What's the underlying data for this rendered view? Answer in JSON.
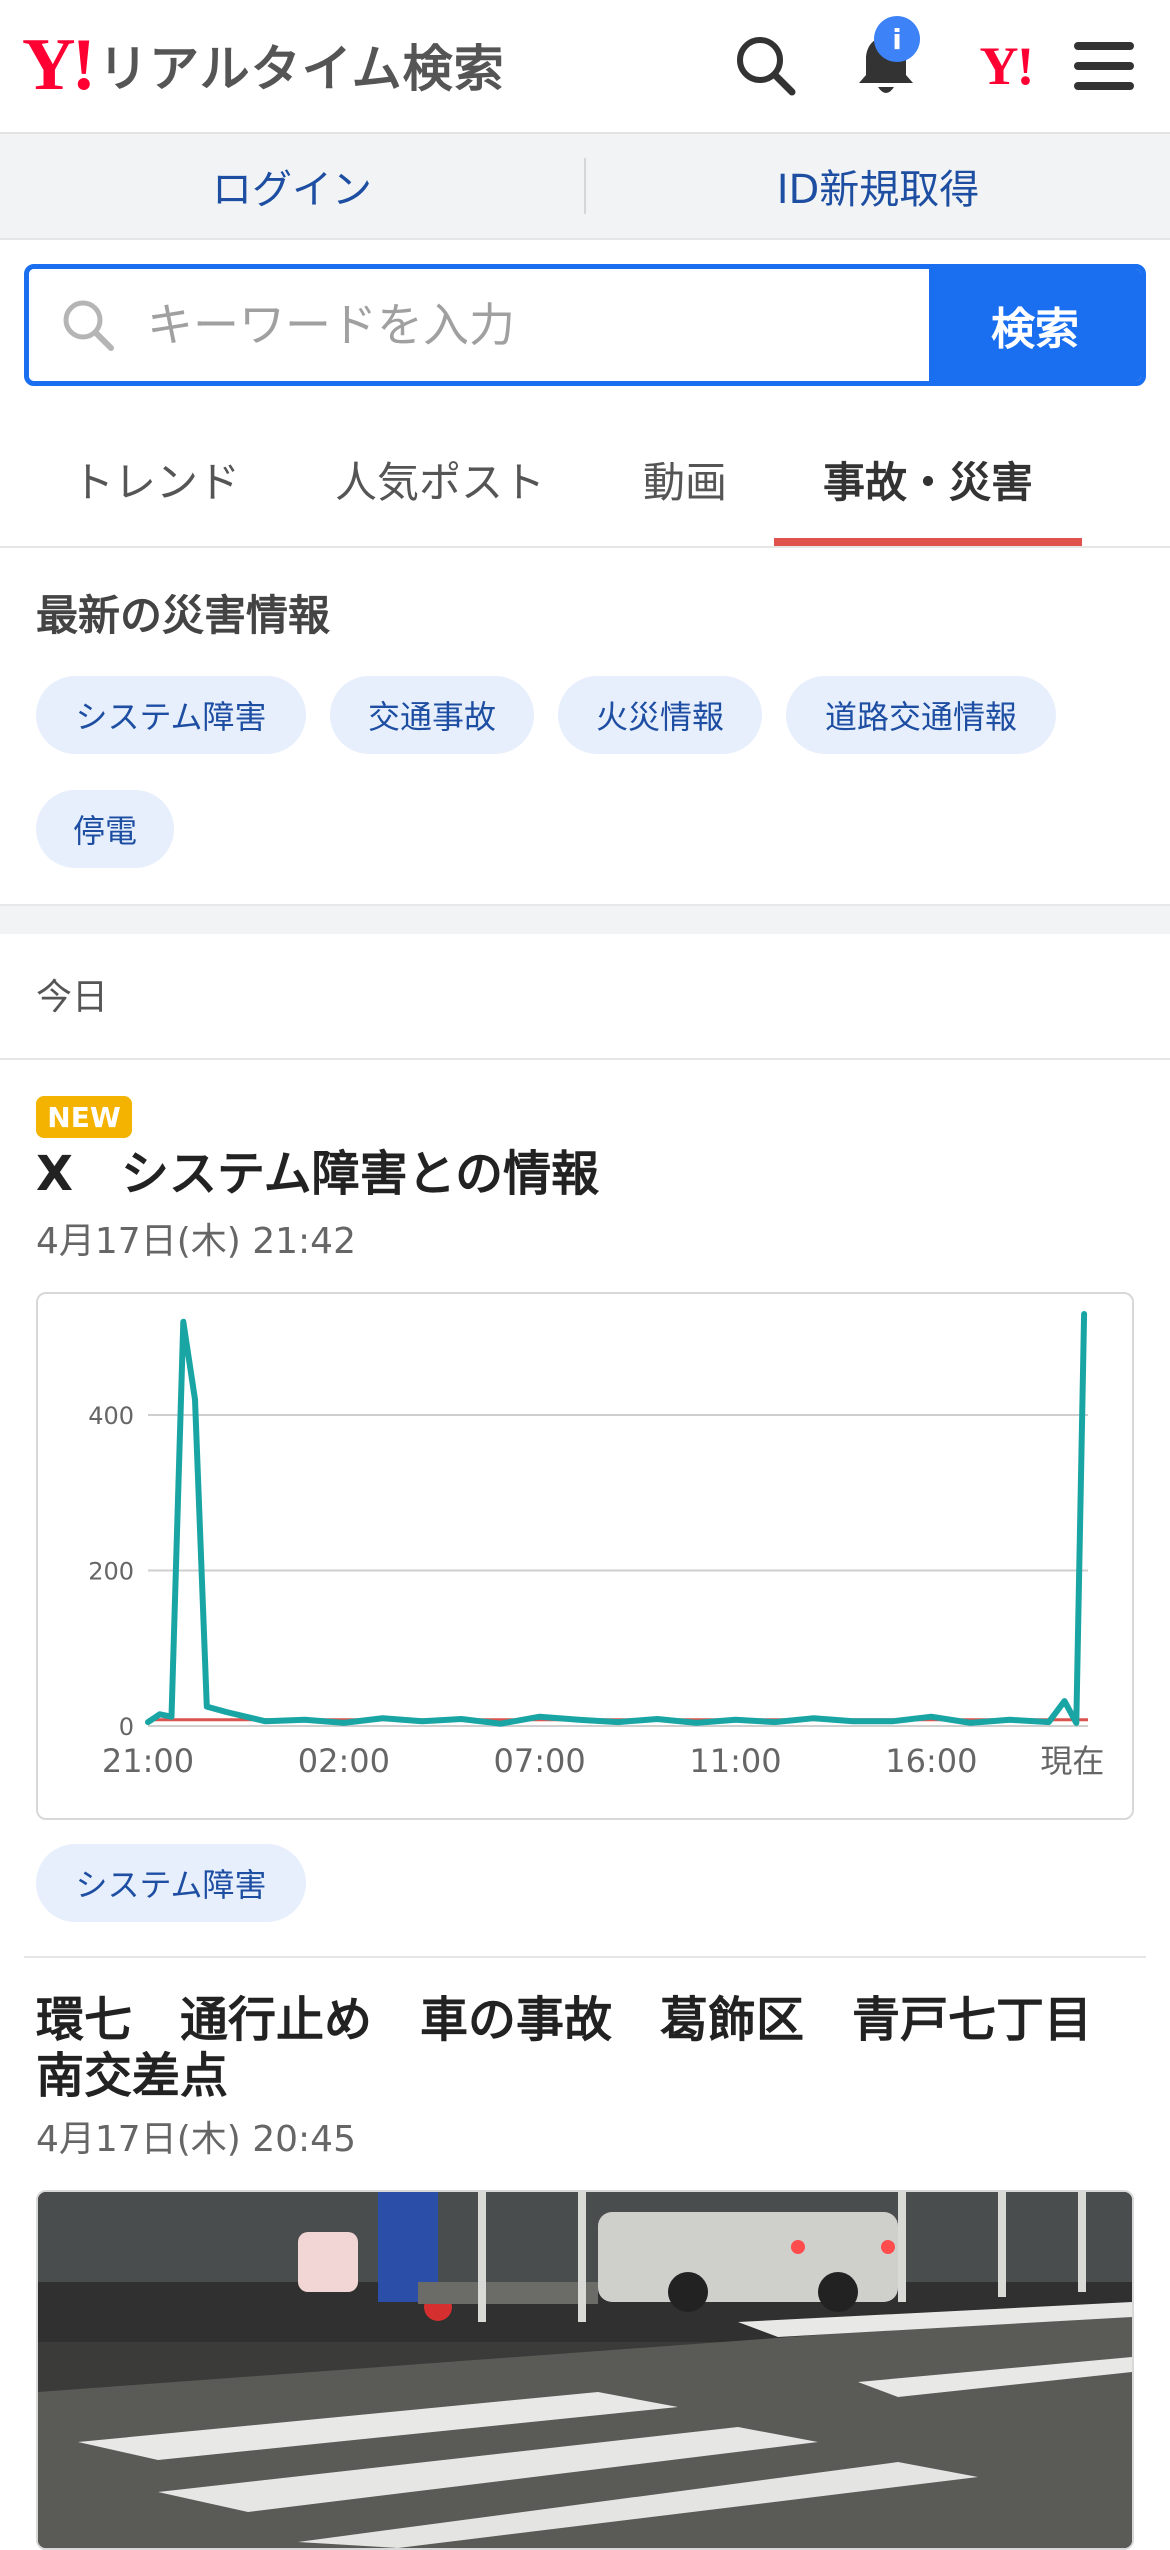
{
  "header": {
    "logo_mark": "Y!",
    "logo_text": "リアルタイム検索",
    "notification_badge": "i",
    "yahoo_mark": "Y!"
  },
  "auth": {
    "login_label": "ログイン",
    "signup_label": "ID新規取得"
  },
  "search": {
    "placeholder": "キーワードを入力",
    "button_label": "検索"
  },
  "tabs": [
    {
      "label": "トレンド",
      "active": false
    },
    {
      "label": "人気ポスト",
      "active": false
    },
    {
      "label": "動画",
      "active": false
    },
    {
      "label": "事故・災害",
      "active": true
    }
  ],
  "latest": {
    "title": "最新の災害情報",
    "chips": [
      "システム障害",
      "交通事故",
      "火災情報",
      "道路交通情報",
      "停電"
    ]
  },
  "day_label": "今日",
  "articles": [
    {
      "badge": "NEW",
      "title": "X　システム障害との情報",
      "date": "4月17日(木) 21:42",
      "tag": "システム障害"
    },
    {
      "title_line1": "環七　通行止め　車の事故　葛飾区　青戸七丁目",
      "title_line2": "南交差点",
      "date": "4月17日(木) 20:45"
    }
  ],
  "chart_data": {
    "type": "line",
    "title": "",
    "xlabel": "",
    "ylabel": "",
    "x_tick_labels": [
      "21:00",
      "02:00",
      "07:00",
      "11:00",
      "16:00",
      "現在"
    ],
    "y_tick_labels": [
      "0",
      "200",
      "400"
    ],
    "ylim": [
      0,
      530
    ],
    "grid": true,
    "baseline": {
      "value": 8,
      "color": "#d9534f"
    },
    "series": [
      {
        "color": "#1aa5a5",
        "x": [
          0,
          0.3,
          0.6,
          0.9,
          1.2,
          1.5,
          2,
          3,
          4,
          5,
          6,
          7,
          8,
          9,
          10,
          11,
          12,
          13,
          14,
          15,
          16,
          17,
          18,
          19,
          20,
          21,
          22,
          23,
          23.4,
          23.7,
          23.9
        ],
        "values": [
          5,
          15,
          12,
          520,
          420,
          25,
          18,
          6,
          8,
          4,
          10,
          6,
          9,
          3,
          12,
          8,
          5,
          9,
          4,
          8,
          5,
          10,
          6,
          6,
          12,
          4,
          8,
          5,
          32,
          4,
          530
        ]
      }
    ]
  },
  "colors": {
    "accent": "#1a6ff0",
    "brand": "#ff0033",
    "tab_underline": "#e0534d",
    "new_badge": "#f5b301",
    "chip_bg": "#e7effd",
    "chip_text": "#1d4ea2"
  }
}
